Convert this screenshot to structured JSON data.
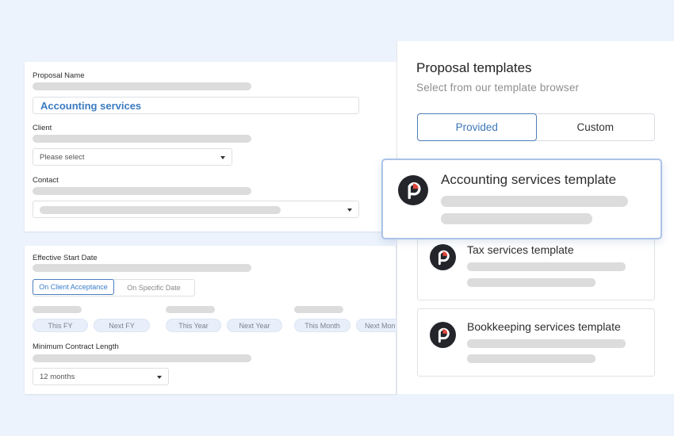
{
  "form": {
    "proposal_name": {
      "label": "Proposal Name",
      "value": "Accounting services"
    },
    "client": {
      "label": "Client",
      "placeholder": "Please select"
    },
    "contact": {
      "label": "Contact"
    },
    "effective_start_date": {
      "label": "Effective Start Date",
      "options": [
        {
          "label": "On Client Acceptance",
          "active": true
        },
        {
          "label": "On Specific Date",
          "active": false
        }
      ],
      "quick_picks": [
        "This FY",
        "Next FY",
        "This Year",
        "Next Year",
        "This Month",
        "Next Mon"
      ]
    },
    "minimum_contract_length": {
      "label": "Minimum Contract Length",
      "value": "12 months"
    }
  },
  "templates_panel": {
    "title": "Proposal templates",
    "subtitle": "Select from our template browser",
    "tabs": [
      {
        "label": "Provided",
        "active": true
      },
      {
        "label": "Custom",
        "active": false
      }
    ],
    "templates": [
      {
        "name": "Accounting services template",
        "featured": true
      },
      {
        "name": "Tax services template",
        "featured": false
      },
      {
        "name": "Bookkeeping services template",
        "featured": false
      }
    ]
  },
  "colors": {
    "background": "#edf3fd",
    "accent": "#3a7dc9",
    "logo_dark": "#23252a",
    "logo_red": "#e0463c",
    "skeleton": "#dcdcdc"
  }
}
